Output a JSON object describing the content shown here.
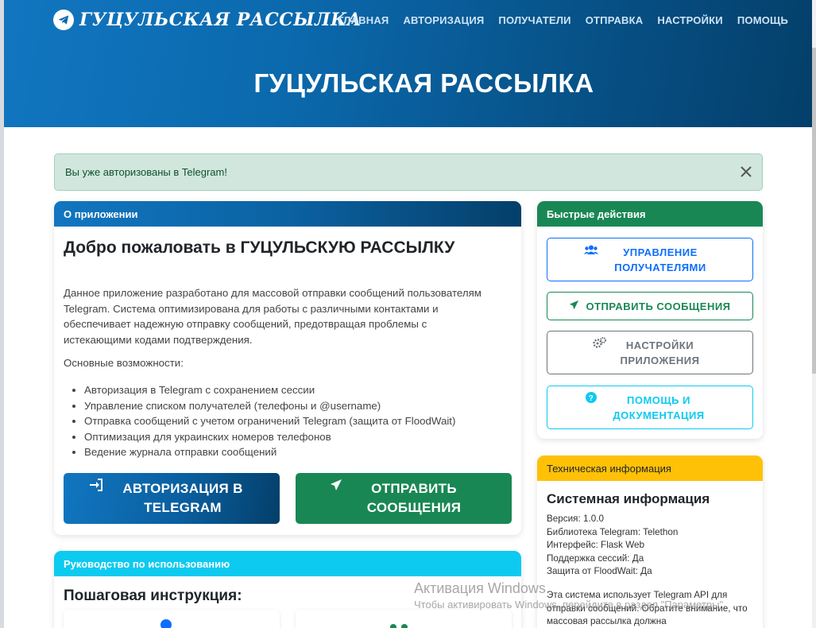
{
  "brand": {
    "name": "ГУЦУЛЬСКАЯ РАССЫЛКА",
    "icon": "telegram-plane-icon"
  },
  "nav": {
    "items": [
      {
        "label": "ГЛАВНАЯ"
      },
      {
        "label": "АВТОРИЗАЦИЯ"
      },
      {
        "label": "ПОЛУЧАТЕЛИ"
      },
      {
        "label": "ОТПРАВКА"
      },
      {
        "label": "НАСТРОЙКИ"
      },
      {
        "label": "ПОМОЩЬ"
      }
    ]
  },
  "hero": {
    "title": "ГУЦУЛЬСКАЯ РАССЫЛКА"
  },
  "alert": {
    "text": "Вы уже авторизованы в Telegram!",
    "close_icon": "close-icon"
  },
  "about": {
    "header": "О приложении",
    "heading": "Добро пожаловать в ГУЦУЛЬСКУЮ РАССЫЛКУ",
    "intro": "Данное приложение разработано для массовой отправки сообщений пользователям Telegram. Система оптимизирована для работы с различными контактами и обеспечивает надежную отправку сообщений, предотвращая проблемы с истекающими кодами подтверждения.",
    "features_title": "Основные возможности:",
    "features": [
      "Авторизация в Telegram с сохранением сессии",
      "Управление списком получателей (телефоны и @username)",
      "Отправка сообщений с учетом ограничений Telegram (защита от FloodWait)",
      "Оптимизация для украинских номеров телефонов",
      "Ведение журнала отправки сообщений"
    ],
    "auth_button": "АВТОРИЗАЦИЯ В TELEGRAM",
    "send_button": "ОТПРАВИТЬ СООБЩЕНИЯ"
  },
  "guide": {
    "header": "Руководство по использованию",
    "heading": "Пошаговая инструкция:"
  },
  "quick": {
    "header": "Быстрые действия",
    "buttons": [
      {
        "label": "УПРАВЛЕНИЕ ПОЛУЧАТЕЛЯМИ",
        "icon": "users-icon"
      },
      {
        "label": "ОТПРАВИТЬ СООБЩЕНИЯ",
        "icon": "paper-plane-icon"
      },
      {
        "label": "НАСТРОЙКИ ПРИЛОЖЕНИЯ",
        "icon": "cogs-icon"
      },
      {
        "label": "ПОМОЩЬ И ДОКУМЕНТАЦИЯ",
        "icon": "question-circle-icon"
      }
    ]
  },
  "tech": {
    "header": "Техническая информация",
    "heading": "Системная информация",
    "lines": [
      "Версия: 1.0.0",
      "Библиотека Telegram: Telethon",
      "Интерфейс: Flask Web",
      "Поддержка сессий: Да",
      "Защита от FloodWait: Да"
    ],
    "note": "Эта система использует Telegram API для отправки сообщений. Обратите внимание, что массовая рассылка должна"
  },
  "watermark": {
    "title": "Активация Windows",
    "subtitle": "Чтобы активировать Windows, перейдите в раздел \"Параметры\"."
  },
  "colors": {
    "primary": "#0d6efd",
    "success": "#198754",
    "info": "#0dcaf0",
    "warning": "#ffc107",
    "secondary": "#6c757d",
    "hero": "#0b69ad"
  }
}
